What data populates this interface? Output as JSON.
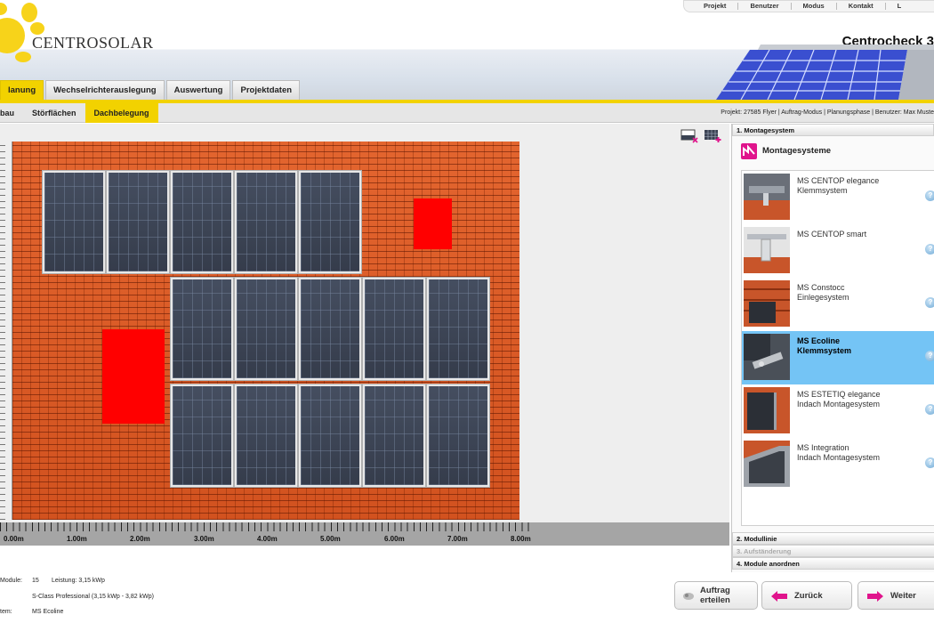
{
  "header": {
    "logo_text": "CENTROSOLAR",
    "app_title": "Centrocheck 3",
    "top_nav": [
      "Projekt",
      "Benutzer",
      "Modus",
      "Kontakt",
      "L"
    ]
  },
  "main_tabs": [
    {
      "label": "lanung",
      "active": true
    },
    {
      "label": "Wechselrichterauslegung",
      "active": false
    },
    {
      "label": "Auswertung",
      "active": false
    },
    {
      "label": "Projektdaten",
      "active": false
    }
  ],
  "sub_tabs": [
    {
      "label": "bau",
      "active": false
    },
    {
      "label": "Störflächen",
      "active": false
    },
    {
      "label": "Dachbelegung",
      "active": true
    }
  ],
  "project_info": "Projekt: 27585 Flyer | Auftrag-Modus | Planungsphase | Benutzer: Max Muste",
  "canvas": {
    "ruler_labels": [
      "0.00m",
      "1.00m",
      "2.00m",
      "3.00m",
      "4.00m",
      "5.00m",
      "6.00m",
      "7.00m",
      "8.00m"
    ],
    "tools": [
      "select-area-icon",
      "add-modules-icon"
    ]
  },
  "right_panel": {
    "step1": "1. Montagesystem",
    "section_title": "Montagesysteme",
    "systems": [
      {
        "name": "MS CENTOP elegance",
        "sub": "Klemmsystem",
        "selected": false
      },
      {
        "name": "MS CENTOP smart",
        "sub": "",
        "selected": false
      },
      {
        "name": "MS Constocc",
        "sub": "Einlegesystem",
        "selected": false
      },
      {
        "name": "MS Ecoline",
        "sub": "Klemmsystem",
        "selected": true
      },
      {
        "name": "MS ESTETIQ elegance",
        "sub": "Indach Montagesystem",
        "selected": false
      },
      {
        "name": "MS Integration",
        "sub": "Indach Montagesystem",
        "selected": false
      }
    ],
    "step2": "2. Modullinie",
    "step3": "3. Aufständerung",
    "step4": "4. Module anordnen"
  },
  "footer": {
    "module_label": "Module:",
    "module_count": "15",
    "leistung": "Leistung: 3,15 kWp",
    "module_type": "S-Class Professional (3,15 kWp - 3,82 kWp)",
    "system_label": "tem:",
    "system_value": "MS Ecoline",
    "btn_order": "Auftrag erteilen",
    "btn_back": "Zurück",
    "btn_next": "Weiter"
  },
  "colors": {
    "accent_yellow": "#f2d200",
    "selection_blue": "#74c4f5",
    "obstacle_red": "#ff0000",
    "roof_tile": "#d95a28",
    "arrow_magenta": "#e0148c"
  }
}
